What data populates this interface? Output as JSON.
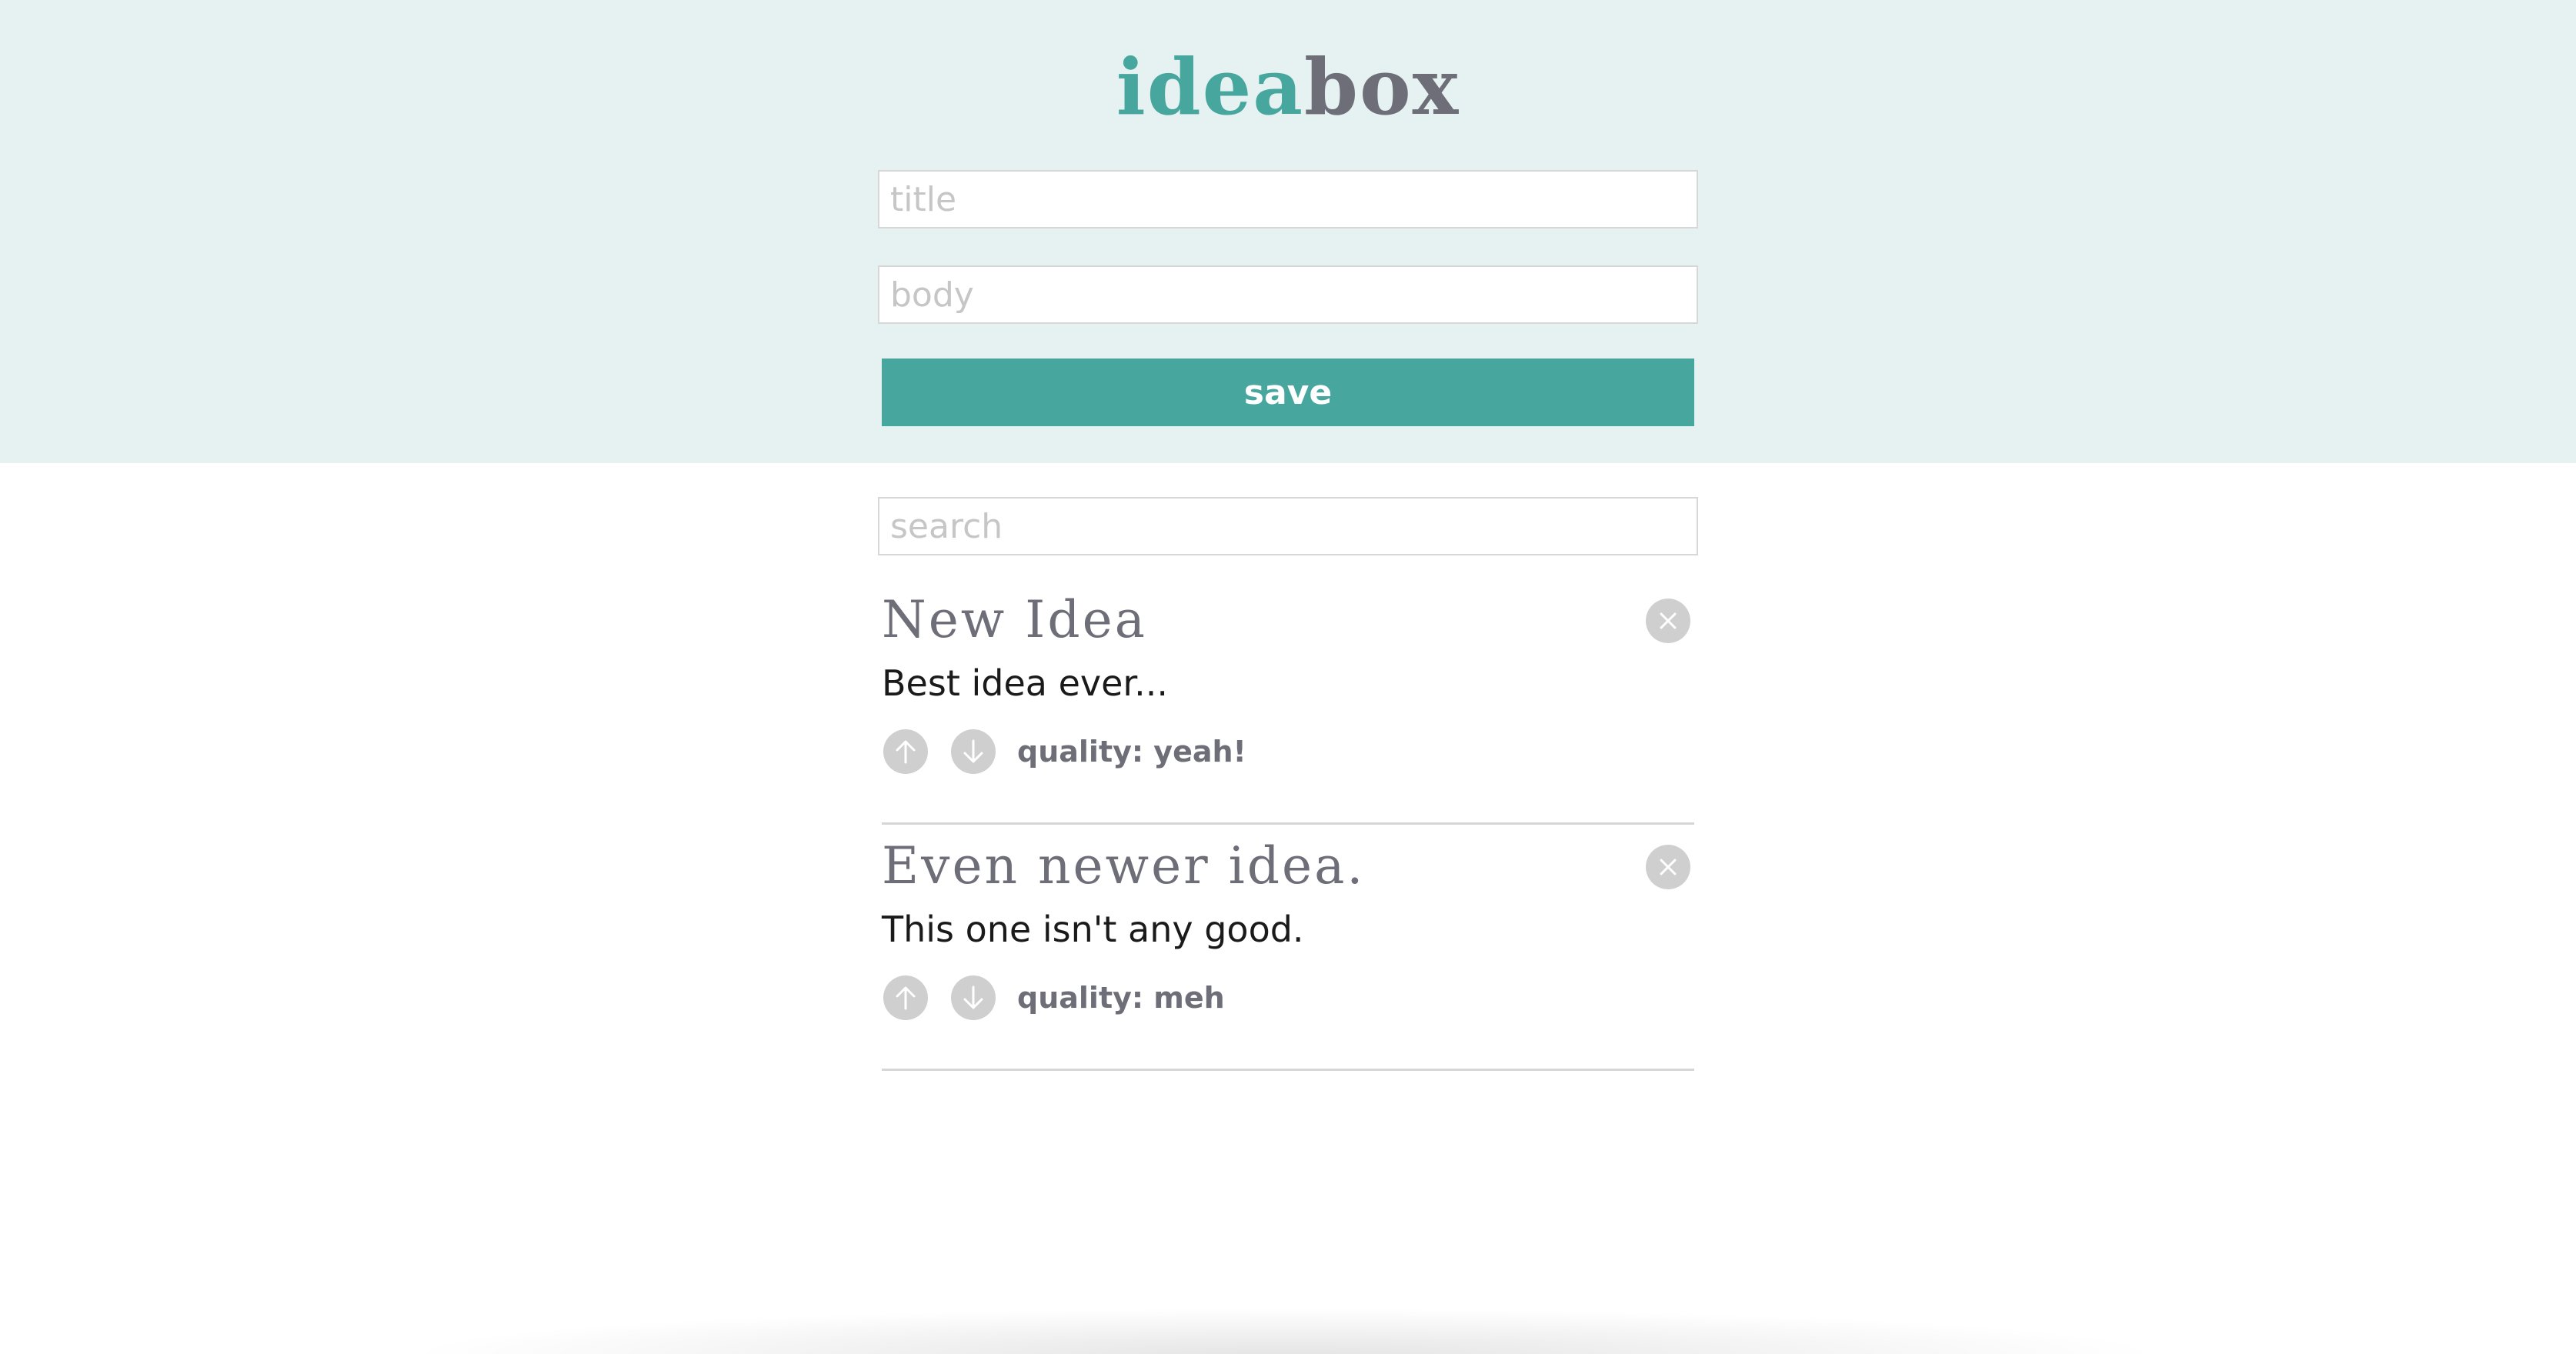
{
  "app": {
    "logo_part_a": "idea",
    "logo_part_b": "box"
  },
  "form": {
    "title_placeholder": "title",
    "body_placeholder": "body",
    "save_label": "save"
  },
  "search": {
    "placeholder": "search"
  },
  "ideas": [
    {
      "title": "New Idea",
      "body": "Best idea ever...",
      "quality": "quality: yeah!"
    },
    {
      "title": "Even newer idea.",
      "body": "This one isn't any good.",
      "quality": "quality: meh"
    }
  ],
  "icons": {
    "delete": "close-icon",
    "upvote": "arrow-up-icon",
    "downvote": "arrow-down-icon"
  },
  "colors": {
    "accent": "#47a79e",
    "header_background": "#e6f2f1",
    "secondary_text": "#6d6e78",
    "icon_button": "#cfcfcf"
  }
}
